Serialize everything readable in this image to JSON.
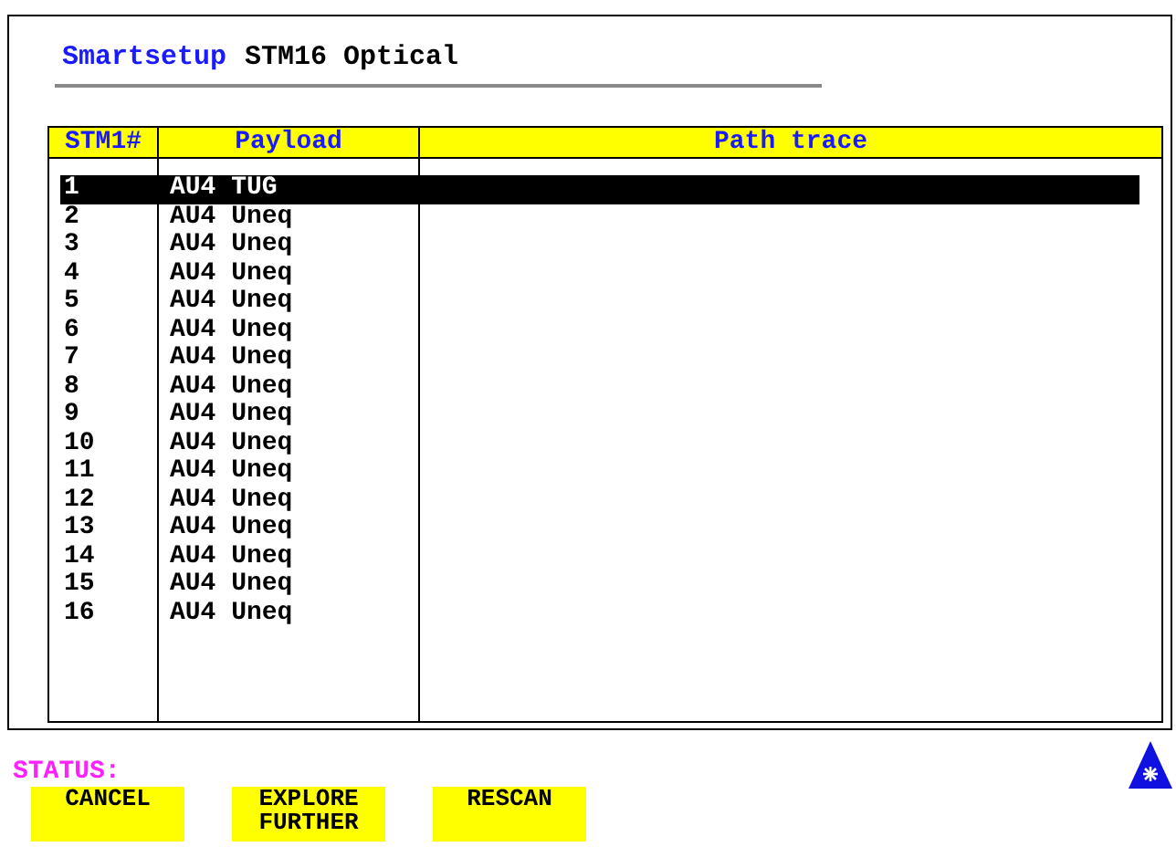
{
  "header": {
    "mode": "Smartsetup",
    "title": "STM16 Optical"
  },
  "table": {
    "columns": [
      "STM1#",
      "Payload",
      "Path trace"
    ],
    "rows": [
      {
        "stm1": "1",
        "payload": "AU4 TUG",
        "selected": true
      },
      {
        "stm1": "2",
        "payload": "AU4 Uneq",
        "selected": false
      },
      {
        "stm1": "3",
        "payload": "AU4 Uneq",
        "selected": false
      },
      {
        "stm1": "4",
        "payload": "AU4 Uneq",
        "selected": false
      },
      {
        "stm1": "5",
        "payload": "AU4 Uneq",
        "selected": false
      },
      {
        "stm1": "6",
        "payload": "AU4 Uneq",
        "selected": false
      },
      {
        "stm1": "7",
        "payload": "AU4 Uneq",
        "selected": false
      },
      {
        "stm1": "8",
        "payload": "AU4 Uneq",
        "selected": false
      },
      {
        "stm1": "9",
        "payload": "AU4 Uneq",
        "selected": false
      },
      {
        "stm1": "10",
        "payload": "AU4 Uneq",
        "selected": false
      },
      {
        "stm1": "11",
        "payload": "AU4 Uneq",
        "selected": false
      },
      {
        "stm1": "12",
        "payload": "AU4 Uneq",
        "selected": false
      },
      {
        "stm1": "13",
        "payload": "AU4 Uneq",
        "selected": false
      },
      {
        "stm1": "14",
        "payload": "AU4 Uneq",
        "selected": false
      },
      {
        "stm1": "15",
        "payload": "AU4 Uneq",
        "selected": false
      },
      {
        "stm1": "16",
        "payload": "AU4 Uneq",
        "selected": false
      }
    ]
  },
  "status": {
    "label": "STATUS:"
  },
  "softkeys": [
    "CANCEL",
    "EXPLORE FURTHER",
    "RESCAN"
  ]
}
